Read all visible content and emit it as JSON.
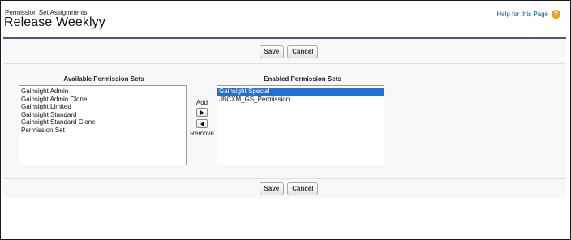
{
  "header": {
    "breadcrumb": "Permission Set Assignments",
    "title": "Release Weeklyy",
    "help_link": "Help for this Page",
    "help_icon": "question-icon"
  },
  "buttons": {
    "save": "Save",
    "cancel": "Cancel"
  },
  "available": {
    "label": "Available Permission Sets",
    "items": [
      "Gainsight Admin",
      "Gainsight Admin Clone",
      "Gainsight Limited",
      "Gainsight Standard",
      "Gainsight Standard Clone",
      "Permission Set"
    ]
  },
  "enabled": {
    "label": "Enabled Permission Sets",
    "items": [
      "Gainsight Special",
      "JBCXM_GS_Permission"
    ],
    "selected_index": 0
  },
  "mover": {
    "add_label": "Add",
    "remove_label": "Remove"
  },
  "colors": {
    "selection": "#1f6fd6",
    "panel_border": "#4e5a73",
    "help_icon": "#e7a116",
    "link": "#015ba7"
  }
}
